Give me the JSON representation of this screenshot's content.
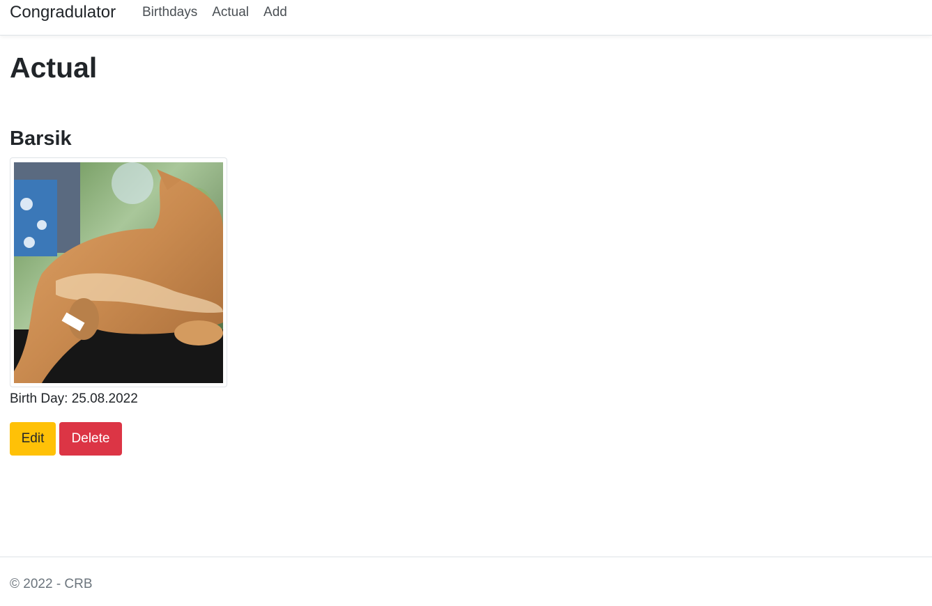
{
  "navbar": {
    "brand": "Congradulator",
    "links": [
      {
        "label": "Birthdays"
      },
      {
        "label": "Actual"
      },
      {
        "label": "Add"
      }
    ]
  },
  "main": {
    "title": "Actual",
    "card": {
      "name": "Barsik",
      "photo_icon": "cat-photo",
      "birth_day_label": "Birth Day: 25.08.2022",
      "edit_label": "Edit",
      "delete_label": "Delete"
    }
  },
  "footer": {
    "text": "© 2022 - CRB"
  },
  "colors": {
    "edit_button": "#ffc107",
    "delete_button": "#dc3545",
    "footer_text": "#6c757d",
    "border": "#dee2e6"
  }
}
